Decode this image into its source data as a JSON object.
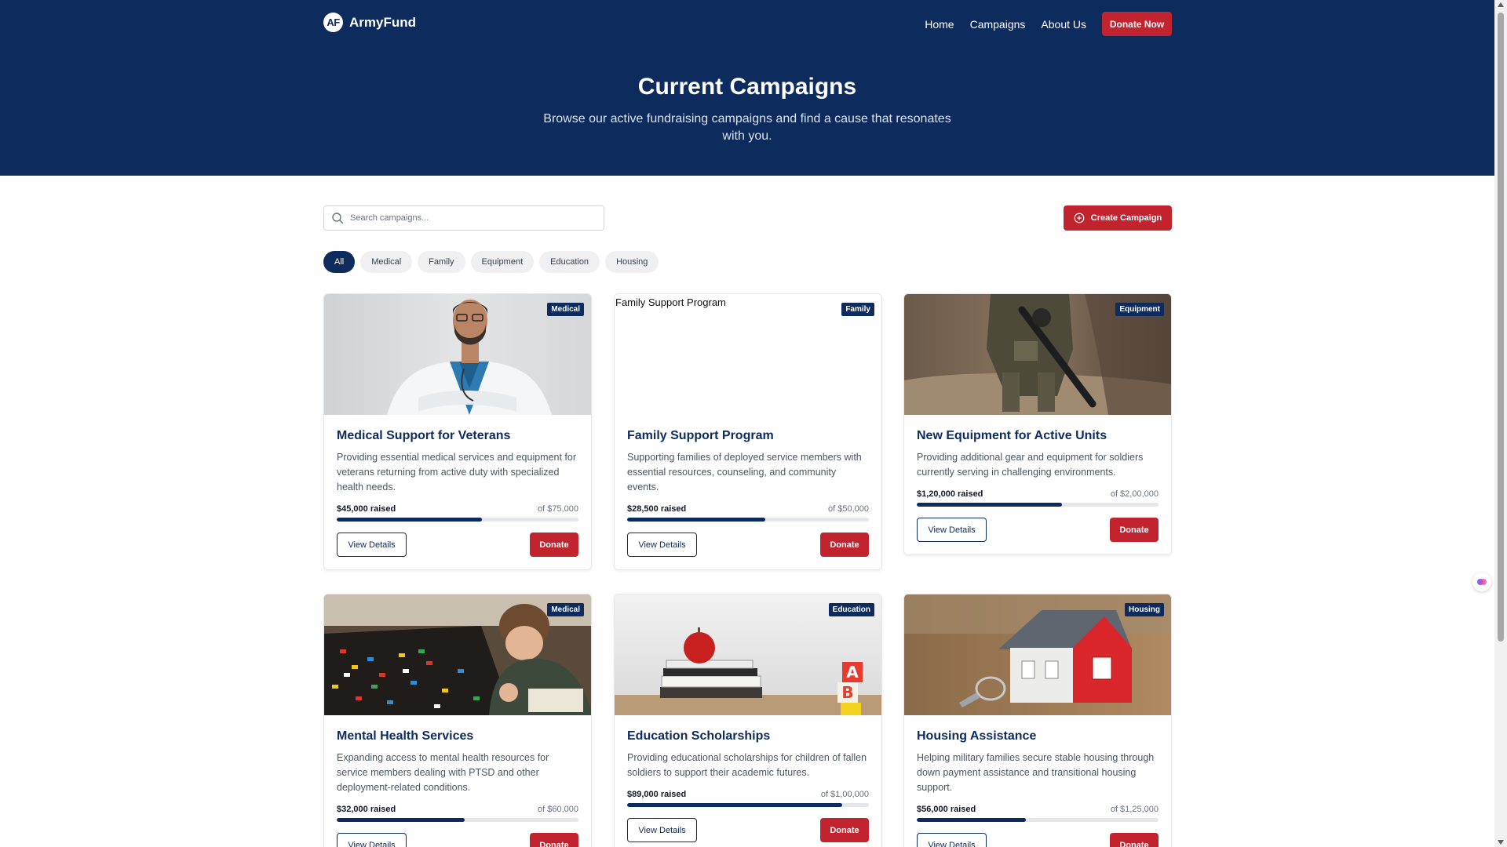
{
  "nav": {
    "logo_badge": "AF",
    "logo_text": "ArmyFund",
    "links": [
      "Home",
      "Campaigns",
      "About Us"
    ],
    "donate_label": "Donate Now"
  },
  "hero": {
    "title": "Current Campaigns",
    "subtitle": "Browse our active fundraising campaigns and find a cause that resonates with you."
  },
  "search": {
    "placeholder": "Search campaigns...",
    "icon": "search-icon"
  },
  "create_button": {
    "label": "Create Campaign",
    "icon": "plus-circle-icon"
  },
  "filters": {
    "items": [
      "All",
      "Medical",
      "Family",
      "Equipment",
      "Education",
      "Housing"
    ],
    "active": "All"
  },
  "cards": [
    {
      "tag": "Medical",
      "title": "Medical Support for Veterans",
      "desc": "Providing essential medical services and equipment for veterans returning from active duty with specialized health needs.",
      "raised": "$45,000 raised",
      "goal": "of $75,000",
      "progress": 0.6,
      "view_label": "View Details",
      "donate_label": "Donate",
      "image": "doctor"
    },
    {
      "tag": "Family",
      "title": "Family Support Program",
      "desc": "Supporting families of deployed service members with essential resources, counseling, and community events.",
      "raised": "$28,500 raised",
      "goal": "of $50,000",
      "progress": 0.57,
      "view_label": "View Details",
      "donate_label": "Donate",
      "image": "broken",
      "alt": "Family Support Program"
    },
    {
      "tag": "Equipment",
      "title": "New Equipment for Active Units",
      "desc": "Providing additional gear and equipment for soldiers currently serving in challenging environments.",
      "raised": "$1,20,000 raised",
      "goal": "of $2,00,000",
      "progress": 0.6,
      "view_label": "View Details",
      "donate_label": "Donate",
      "image": "soldier"
    },
    {
      "tag": "Medical",
      "title": "Mental Health Services",
      "desc": "Expanding access to mental health resources for service members dealing with PTSD and other deployment-related conditions.",
      "raised": "$32,000 raised",
      "goal": "of $60,000",
      "progress": 0.53,
      "view_label": "View Details",
      "donate_label": "Donate",
      "image": "lego"
    },
    {
      "tag": "Education",
      "title": "Education Scholarships",
      "desc": "Providing educational scholarships for children of fallen soldiers to support their academic futures.",
      "raised": "$89,000 raised",
      "goal": "of $1,00,000",
      "progress": 0.89,
      "view_label": "View Details",
      "donate_label": "Donate",
      "image": "books"
    },
    {
      "tag": "Housing",
      "title": "Housing Assistance",
      "desc": "Helping military families secure stable housing through down payment assistance and transitional housing support.",
      "raised": "$56,000 raised",
      "goal": "of $1,25,000",
      "progress": 0.45,
      "view_label": "View Details",
      "donate_label": "Donate",
      "image": "house"
    }
  ],
  "colors": {
    "navy": "#0d2b5c",
    "red": "#c1232f"
  }
}
